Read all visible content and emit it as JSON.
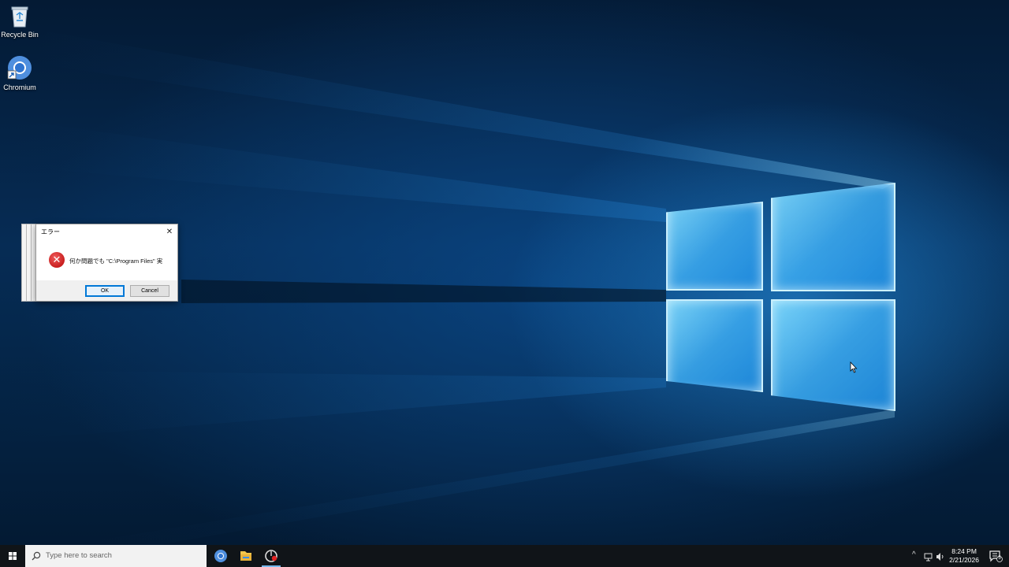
{
  "desktop": {
    "icons": [
      {
        "label": "Recycle Bin",
        "icon": "recycle-bin-icon"
      },
      {
        "label": "Chromium",
        "icon": "chromium-icon"
      }
    ]
  },
  "dialog": {
    "title": "エラー",
    "close_glyph": "✕",
    "icon": "error-icon",
    "message": "何か問題でも \"C:\\Program Files\" 実",
    "ok_label": "OK",
    "cancel_label": "Cancel"
  },
  "taskbar": {
    "search_placeholder": "Type here to search",
    "apps": [
      "chromium-icon",
      "file-explorer-icon",
      "app-icon"
    ],
    "tray_chevron": "^",
    "time": "8:24 PM",
    "date": "2/21/2026",
    "notification_count": "5"
  },
  "colors": {
    "taskbar": "#101418",
    "wallpaper_dark": "#041a34",
    "window_light": "#82dcff",
    "error_red": "#c81e1e",
    "accent": "#0078d7"
  }
}
